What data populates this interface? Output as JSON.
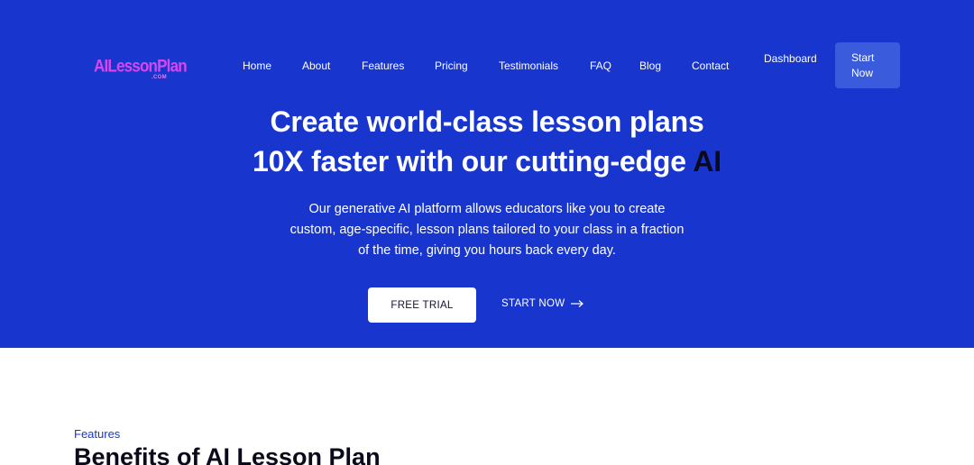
{
  "colors": {
    "hero_bg": "#1836cd",
    "logo": "#d946ef",
    "start_button": "#3a5bdc",
    "accent": "#1836cd"
  },
  "logo": {
    "text": "AILessonPlan",
    "sub": ".COM"
  },
  "nav": {
    "items": [
      "Home",
      "About",
      "Features",
      "Pricing",
      "Testimonials",
      "FAQ",
      "Blog",
      "Contact"
    ],
    "dashboard": "Dashboard",
    "start_line1": "Start",
    "start_line2": "Now"
  },
  "hero": {
    "headline_line1": "Create world-class lesson plans",
    "headline_line2_main": "10X faster with our cutting-edge ",
    "headline_line2_accent": "AI",
    "subtext": "Our generative AI platform allows educators like you to create custom, age-specific, lesson plans tailored to your class in a fraction of the time, giving you hours back every day.",
    "free_trial": "FREE TRIAL",
    "start_now": "START NOW",
    "arrow_icon": "arrow-right-icon"
  },
  "features": {
    "kicker": "Features",
    "title": "Benefits of AI Lesson Plan"
  }
}
